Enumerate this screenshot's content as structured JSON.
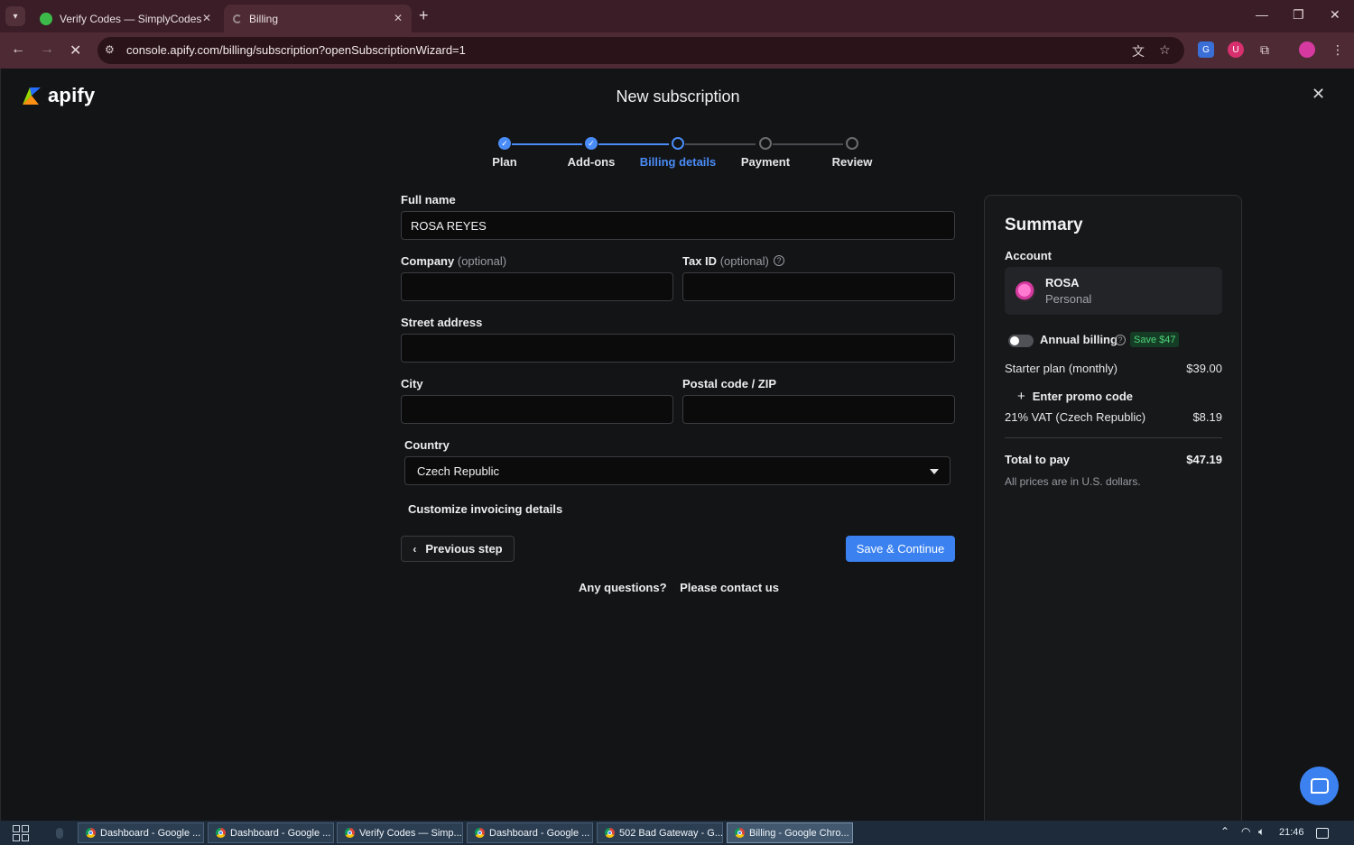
{
  "browser": {
    "tabs": [
      {
        "title": "Verify Codes — SimplyCodes",
        "active": false
      },
      {
        "title": "Billing",
        "active": true
      }
    ],
    "url": "console.apify.com/billing/subscription?openSubscriptionWizard=1"
  },
  "header": {
    "logo_text": "apify",
    "title": "New subscription"
  },
  "stepper": [
    {
      "label": "Plan",
      "state": "done"
    },
    {
      "label": "Add-ons",
      "state": "done"
    },
    {
      "label": "Billing details",
      "state": "active"
    },
    {
      "label": "Payment",
      "state": "todo"
    },
    {
      "label": "Review",
      "state": "todo"
    }
  ],
  "form": {
    "full_name": {
      "label": "Full name",
      "value": "ROSA REYES"
    },
    "company": {
      "label": "Company",
      "optional": "(optional)",
      "value": ""
    },
    "tax_id": {
      "label": "Tax ID",
      "optional": "(optional)",
      "value": ""
    },
    "street": {
      "label": "Street address",
      "value": ""
    },
    "city": {
      "label": "City",
      "value": ""
    },
    "postal": {
      "label": "Postal code / ZIP",
      "value": ""
    },
    "country": {
      "label": "Country",
      "value": "Czech Republic"
    },
    "customize_link": "Customize invoicing details",
    "prev_button": "Previous step",
    "save_button": "Save & Continue",
    "questions": "Any questions?",
    "contact_link": "Please contact us"
  },
  "summary": {
    "title": "Summary",
    "account_label": "Account",
    "account_name": "ROSA",
    "account_type": "Personal",
    "annual_billing": "Annual billing",
    "annual_billing_enabled": false,
    "save_badge": "Save $47",
    "plan_label": "Starter plan (monthly)",
    "plan_price": "$39.00",
    "promo": "Enter promo code",
    "vat_label": "21% VAT (Czech Republic)",
    "vat_price": "$8.19",
    "total_label": "Total to pay",
    "total_price": "$47.19",
    "note": "All prices are in U.S. dollars."
  },
  "taskbar": {
    "items": [
      {
        "label": "Dashboard - Google ...",
        "active": false
      },
      {
        "label": "Dashboard - Google ...",
        "active": false
      },
      {
        "label": "Verify Codes — Simp...",
        "active": false
      },
      {
        "label": "Dashboard - Google ...",
        "active": false
      },
      {
        "label": "502 Bad Gateway - G...",
        "active": false
      },
      {
        "label": "Billing - Google Chro...",
        "active": true
      }
    ],
    "clock": "21:46"
  },
  "colors": {
    "accent": "#3b82f0",
    "tabbar": "#3a1d26",
    "toolbar": "#4e2a34",
    "page_bg": "#131416",
    "save_badge_text": "#4fd27a"
  }
}
